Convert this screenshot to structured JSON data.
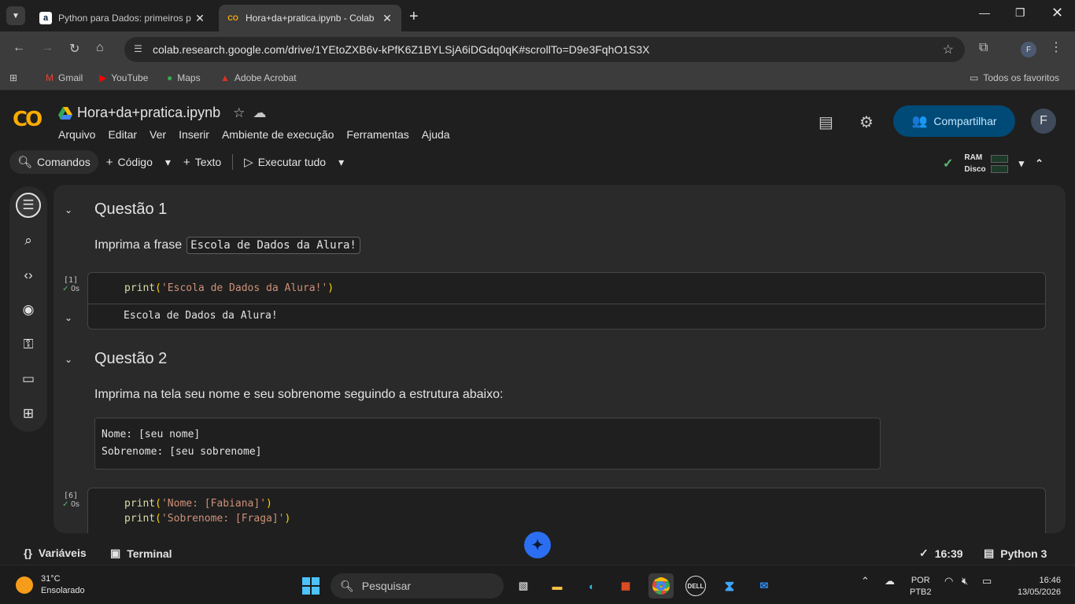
{
  "browser": {
    "tabs": [
      {
        "title": "Python para Dados: primeiros p",
        "favicon": "a"
      },
      {
        "title": "Hora+da+pratica.ipynb - Colab",
        "favicon": "CO"
      }
    ],
    "url": "colab.research.google.com/drive/1YEtoZXB6v-kPfK6Z1BYLSjA6iDGdq0qK#scrollTo=D9e3FqhO1S3X",
    "profile_initial": "F",
    "bookmarks": [
      "Gmail",
      "YouTube",
      "Maps",
      "Adobe Acrobat"
    ],
    "all_bookmarks": "Todos os favoritos"
  },
  "colab": {
    "logo": "CO",
    "notebook_title": "Hora+da+pratica.ipynb",
    "menu": [
      "Arquivo",
      "Editar",
      "Ver",
      "Inserir",
      "Ambiente de execução",
      "Ferramentas",
      "Ajuda"
    ],
    "share_label": "Compartilhar",
    "user_initial": "F",
    "toolbar": {
      "commands": "Comandos",
      "code": "Código",
      "text": "Texto",
      "run_all": "Executar tudo"
    },
    "resources": {
      "ram": "RAM",
      "disk": "Disco"
    }
  },
  "notebook": {
    "q1": {
      "heading": "Questão 1",
      "text": "Imprima a frase",
      "inline_code": "Escola de Dados da Alura!"
    },
    "cell1": {
      "exec_count": "[1]",
      "time": "0s",
      "code_fn": "print",
      "code_str": "'Escola de Dados da Alura!'",
      "output": "Escola de Dados da Alura!"
    },
    "q2": {
      "heading": "Questão 2",
      "text": "Imprima na tela seu nome e seu sobrenome seguindo a estrutura abaixo:",
      "pre_line1": "Nome: [seu nome]",
      "pre_line2": "Sobrenome: [seu sobrenome]"
    },
    "cell2": {
      "exec_count": "[6]",
      "time": "0s",
      "line1_fn": "print",
      "line1_str": "'Nome: [Fabiana]'",
      "line2_fn": "print",
      "line2_str": "'Sobrenome: [Fraga]'"
    }
  },
  "statusbar": {
    "variables": "Variáveis",
    "terminal": "Terminal",
    "time": "16:39",
    "runtime": "Python 3"
  },
  "taskbar": {
    "temp": "31°C",
    "weather": "Ensolarado",
    "search": "Pesquisar",
    "lang1": "POR",
    "lang2": "PTB2",
    "clock_time": "16:46",
    "clock_date": "13/05/2026"
  },
  "colors": {
    "accent": "#004a77",
    "logo": "#f9ab00",
    "ok": "#5bb974"
  }
}
